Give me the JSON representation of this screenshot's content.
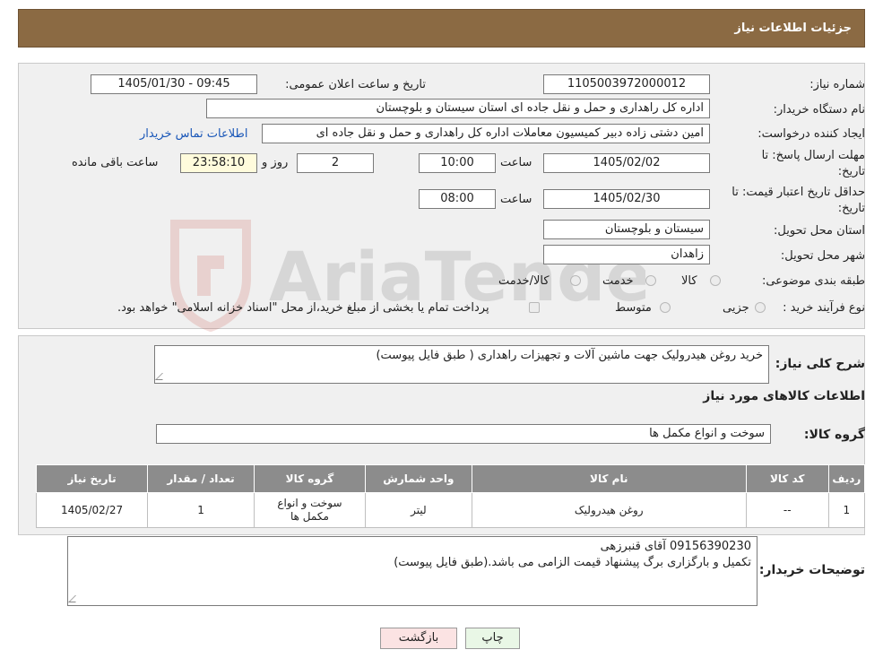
{
  "header": {
    "title": "جزئیات اطلاعات نیاز"
  },
  "form": {
    "need_number": {
      "label": "شماره نیاز:",
      "value": "1105003972000012"
    },
    "announce_datetime": {
      "label": "تاریخ و ساعت اعلان عمومی:",
      "value": "1405/01/30 - 09:45"
    },
    "buyer_org": {
      "label": "نام دستگاه خریدار:",
      "value": "اداره کل راهداری و حمل و نقل جاده ای استان سیستان و بلوچستان"
    },
    "creator": {
      "label": "ایجاد کننده درخواست:",
      "value": "امین دشتی زاده دبیر کمیسیون معاملات اداره کل راهداری و حمل و نقل جاده ای",
      "contact_link": "اطلاعات تماس خریدار"
    },
    "reply_deadline": {
      "label_line1": "مهلت ارسال پاسخ: تا",
      "label_line2": "تاریخ:",
      "date": "1405/02/02",
      "time_label": "ساعت",
      "time": "10:00",
      "days": "2",
      "days_label": "روز و",
      "remaining": "23:58:10",
      "remaining_label": "ساعت باقی مانده"
    },
    "price_validity": {
      "label_line1": "حداقل تاریخ اعتبار قیمت: تا",
      "label_line2": "تاریخ:",
      "date": "1405/02/30",
      "time_label": "ساعت",
      "time": "08:00"
    },
    "delivery_province": {
      "label": "استان محل تحویل:",
      "value": "سیستان و بلوچستان"
    },
    "delivery_city": {
      "label": "شهر محل تحویل:",
      "value": "زاهدان"
    },
    "category": {
      "label": "طبقه بندی موضوعی:",
      "options": [
        "کالا",
        "خدمت",
        "کالا/خدمت"
      ]
    },
    "process": {
      "label": "نوع فرآیند خرید :",
      "options": [
        "جزیی",
        "متوسط"
      ],
      "note": "پرداخت تمام یا بخشی از مبلغ خرید،از محل \"اسناد خزانه اسلامی\" خواهد بود."
    }
  },
  "summary": {
    "label": "شرح کلی نیاز:",
    "value": "خرید روغن هیدرولیک جهت ماشین آلات و تجهیزات راهداری ( طبق فایل پیوست)",
    "items_heading": "اطلاعات کالاهای مورد نیاز",
    "group_label": "گروه کالا:",
    "group_value": "سوخت و انواع مکمل ها"
  },
  "table": {
    "headers": [
      "ردیف",
      "کد کالا",
      "نام کالا",
      "واحد شمارش",
      "گروه کالا",
      "تعداد / مقدار",
      "تاریخ نیاز"
    ],
    "rows": [
      [
        "1",
        "--",
        "روغن هیدرولیک",
        "لیتر",
        "سوخت و انواع مکمل ها",
        "1",
        "1405/02/27"
      ]
    ]
  },
  "buyer_notes": {
    "label": "توضیحات خریدار:",
    "line1": "09156390230  آقای  قنبرزهی",
    "line2": "تکمیل و بارگزاری برگ پیشنهاد قیمت الزامی می باشد.(طبق فایل پیوست)"
  },
  "buttons": {
    "print": "چاپ",
    "back": "بازگشت"
  },
  "watermark": {
    "text": "AriaTender.neT"
  },
  "colors": {
    "header_bg": "#8b6a43",
    "link": "#1a57b8",
    "table_header": "#8c8c8c",
    "back_btn": "#fbe3e3",
    "print_btn": "#e9f7e6"
  }
}
